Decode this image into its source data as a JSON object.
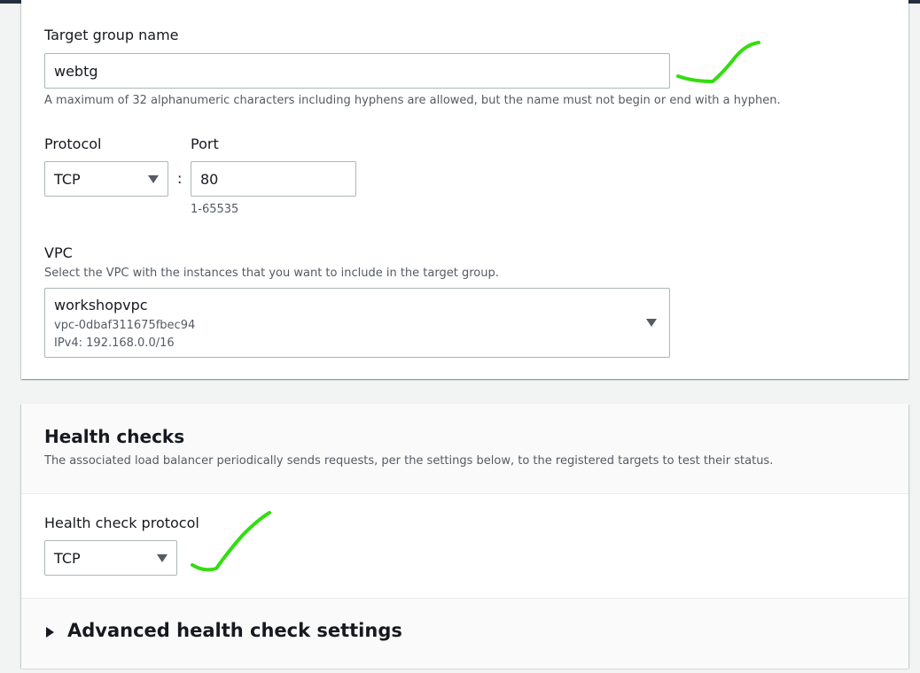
{
  "target_group": {
    "name_label": "Target group name",
    "name_value": "webtg",
    "name_hint": "A maximum of 32 alphanumeric characters including hyphens are allowed, but the name must not begin or end with a hyphen.",
    "protocol_label": "Protocol",
    "protocol_value": "TCP",
    "port_label": "Port",
    "port_value": "80",
    "port_hint": "1-65535",
    "separator": ":",
    "vpc_label": "VPC",
    "vpc_hint": "Select the VPC with the instances that you want to include in the target group.",
    "vpc_name": "workshopvpc",
    "vpc_id": "vpc-0dbaf311675fbec94",
    "vpc_cidr": "IPv4: 192.168.0.0/16"
  },
  "health_checks": {
    "title": "Health checks",
    "description": "The associated load balancer periodically sends requests, per the settings below, to the registered targets to test their status.",
    "protocol_label": "Health check protocol",
    "protocol_value": "TCP",
    "advanced_label": "Advanced health check settings"
  },
  "annotations": {
    "checkmark_color": "#33dd11"
  },
  "icons": {
    "dropdown": "caret-down-icon",
    "expand": "caret-right-icon",
    "annotation": "checkmark-icon"
  }
}
